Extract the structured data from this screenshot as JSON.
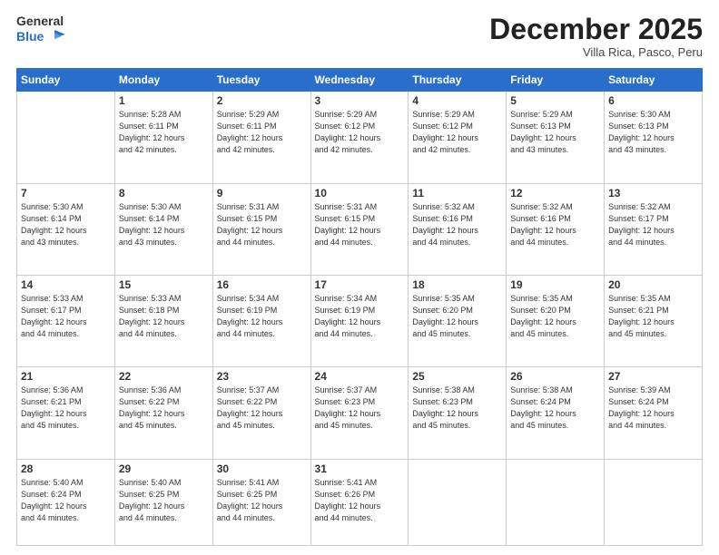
{
  "logo": {
    "general": "General",
    "blue": "Blue"
  },
  "header": {
    "month": "December 2025",
    "location": "Villa Rica, Pasco, Peru"
  },
  "weekdays": [
    "Sunday",
    "Monday",
    "Tuesday",
    "Wednesday",
    "Thursday",
    "Friday",
    "Saturday"
  ],
  "weeks": [
    [
      {
        "day": "",
        "info": ""
      },
      {
        "day": "1",
        "info": "Sunrise: 5:28 AM\nSunset: 6:11 PM\nDaylight: 12 hours\nand 42 minutes."
      },
      {
        "day": "2",
        "info": "Sunrise: 5:29 AM\nSunset: 6:11 PM\nDaylight: 12 hours\nand 42 minutes."
      },
      {
        "day": "3",
        "info": "Sunrise: 5:29 AM\nSunset: 6:12 PM\nDaylight: 12 hours\nand 42 minutes."
      },
      {
        "day": "4",
        "info": "Sunrise: 5:29 AM\nSunset: 6:12 PM\nDaylight: 12 hours\nand 42 minutes."
      },
      {
        "day": "5",
        "info": "Sunrise: 5:29 AM\nSunset: 6:13 PM\nDaylight: 12 hours\nand 43 minutes."
      },
      {
        "day": "6",
        "info": "Sunrise: 5:30 AM\nSunset: 6:13 PM\nDaylight: 12 hours\nand 43 minutes."
      }
    ],
    [
      {
        "day": "7",
        "info": "Sunrise: 5:30 AM\nSunset: 6:14 PM\nDaylight: 12 hours\nand 43 minutes."
      },
      {
        "day": "8",
        "info": "Sunrise: 5:30 AM\nSunset: 6:14 PM\nDaylight: 12 hours\nand 43 minutes."
      },
      {
        "day": "9",
        "info": "Sunrise: 5:31 AM\nSunset: 6:15 PM\nDaylight: 12 hours\nand 44 minutes."
      },
      {
        "day": "10",
        "info": "Sunrise: 5:31 AM\nSunset: 6:15 PM\nDaylight: 12 hours\nand 44 minutes."
      },
      {
        "day": "11",
        "info": "Sunrise: 5:32 AM\nSunset: 6:16 PM\nDaylight: 12 hours\nand 44 minutes."
      },
      {
        "day": "12",
        "info": "Sunrise: 5:32 AM\nSunset: 6:16 PM\nDaylight: 12 hours\nand 44 minutes."
      },
      {
        "day": "13",
        "info": "Sunrise: 5:32 AM\nSunset: 6:17 PM\nDaylight: 12 hours\nand 44 minutes."
      }
    ],
    [
      {
        "day": "14",
        "info": "Sunrise: 5:33 AM\nSunset: 6:17 PM\nDaylight: 12 hours\nand 44 minutes."
      },
      {
        "day": "15",
        "info": "Sunrise: 5:33 AM\nSunset: 6:18 PM\nDaylight: 12 hours\nand 44 minutes."
      },
      {
        "day": "16",
        "info": "Sunrise: 5:34 AM\nSunset: 6:19 PM\nDaylight: 12 hours\nand 44 minutes."
      },
      {
        "day": "17",
        "info": "Sunrise: 5:34 AM\nSunset: 6:19 PM\nDaylight: 12 hours\nand 44 minutes."
      },
      {
        "day": "18",
        "info": "Sunrise: 5:35 AM\nSunset: 6:20 PM\nDaylight: 12 hours\nand 45 minutes."
      },
      {
        "day": "19",
        "info": "Sunrise: 5:35 AM\nSunset: 6:20 PM\nDaylight: 12 hours\nand 45 minutes."
      },
      {
        "day": "20",
        "info": "Sunrise: 5:35 AM\nSunset: 6:21 PM\nDaylight: 12 hours\nand 45 minutes."
      }
    ],
    [
      {
        "day": "21",
        "info": "Sunrise: 5:36 AM\nSunset: 6:21 PM\nDaylight: 12 hours\nand 45 minutes."
      },
      {
        "day": "22",
        "info": "Sunrise: 5:36 AM\nSunset: 6:22 PM\nDaylight: 12 hours\nand 45 minutes."
      },
      {
        "day": "23",
        "info": "Sunrise: 5:37 AM\nSunset: 6:22 PM\nDaylight: 12 hours\nand 45 minutes."
      },
      {
        "day": "24",
        "info": "Sunrise: 5:37 AM\nSunset: 6:23 PM\nDaylight: 12 hours\nand 45 minutes."
      },
      {
        "day": "25",
        "info": "Sunrise: 5:38 AM\nSunset: 6:23 PM\nDaylight: 12 hours\nand 45 minutes."
      },
      {
        "day": "26",
        "info": "Sunrise: 5:38 AM\nSunset: 6:24 PM\nDaylight: 12 hours\nand 45 minutes."
      },
      {
        "day": "27",
        "info": "Sunrise: 5:39 AM\nSunset: 6:24 PM\nDaylight: 12 hours\nand 44 minutes."
      }
    ],
    [
      {
        "day": "28",
        "info": "Sunrise: 5:40 AM\nSunset: 6:24 PM\nDaylight: 12 hours\nand 44 minutes."
      },
      {
        "day": "29",
        "info": "Sunrise: 5:40 AM\nSunset: 6:25 PM\nDaylight: 12 hours\nand 44 minutes."
      },
      {
        "day": "30",
        "info": "Sunrise: 5:41 AM\nSunset: 6:25 PM\nDaylight: 12 hours\nand 44 minutes."
      },
      {
        "day": "31",
        "info": "Sunrise: 5:41 AM\nSunset: 6:26 PM\nDaylight: 12 hours\nand 44 minutes."
      },
      {
        "day": "",
        "info": ""
      },
      {
        "day": "",
        "info": ""
      },
      {
        "day": "",
        "info": ""
      }
    ]
  ]
}
